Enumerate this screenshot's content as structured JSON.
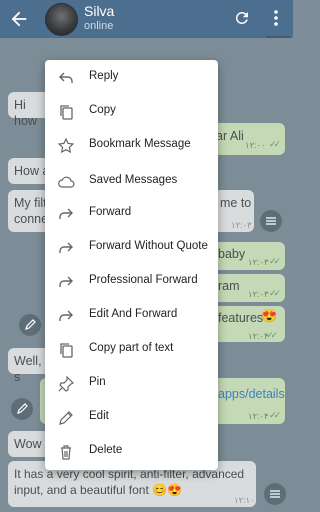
{
  "header": {
    "title": "Silva",
    "status": "online"
  },
  "messages": {
    "m1": "Hi how",
    "m2_tail": "ar Ali",
    "m2_time": "۱۲:۰۰",
    "m3": "How a",
    "m4_line1": "My filt",
    "m4_line2": "conne",
    "m4_tail": "me to",
    "m4_time": "۱۲:۰۳",
    "m5_tail": "baby",
    "m5_time": "۱۲:۰۳",
    "m6_tail": "ram",
    "m6_time": "۱۲:۰۳",
    "m7_tail": "features",
    "m7_time": "۱۲:۰۴",
    "m8": "Well, s",
    "m9_tail": "apps/details",
    "m9_time": "۱۲:۰۴",
    "m10": "Wow",
    "m11": "It has a very cool spirit, anti-filter, advanced input, and a beautiful font",
    "m11_time": "۱۲:۱۰"
  },
  "menu": {
    "items": [
      {
        "label": "Reply",
        "icon": "reply-icon"
      },
      {
        "label": "Copy",
        "icon": "copy-icon"
      },
      {
        "label": "Bookmark Message",
        "icon": "star-icon"
      },
      {
        "label": "Saved Messages",
        "icon": "cloud-icon"
      },
      {
        "label": "Forward",
        "icon": "forward-icon"
      },
      {
        "label": "Forward Without Quote",
        "icon": "forward-icon"
      },
      {
        "label": "Professional Forward",
        "icon": "forward-icon"
      },
      {
        "label": "Edit And Forward",
        "icon": "forward-icon"
      },
      {
        "label": "Copy part of text",
        "icon": "copy-icon"
      },
      {
        "label": "Pin",
        "icon": "pin-icon"
      },
      {
        "label": "Edit",
        "icon": "pencil-icon"
      },
      {
        "label": "Delete",
        "icon": "trash-icon"
      }
    ]
  },
  "colors": {
    "header": "#4d6f8f",
    "chat_background": "#7d8d97",
    "incoming_bubble": "#d9dcdd",
    "outgoing_bubble": "#c5d9b6",
    "menu_background": "#ffffff"
  }
}
